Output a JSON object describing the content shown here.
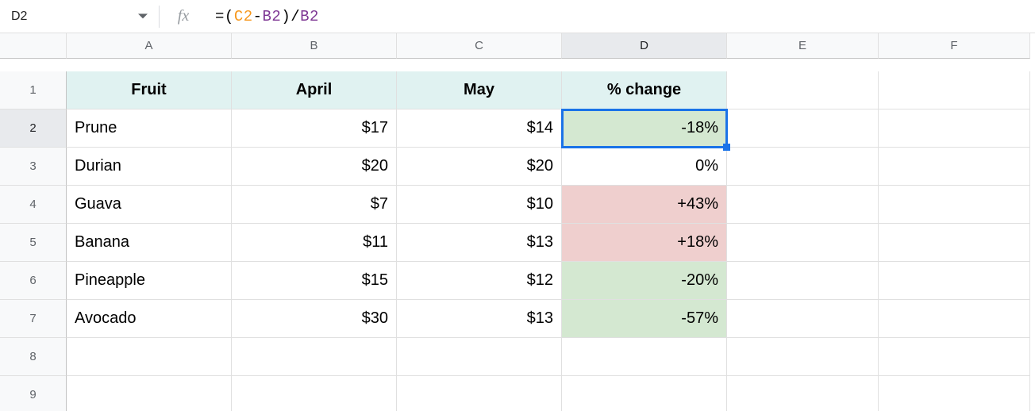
{
  "formula_bar": {
    "cell_ref": "D2",
    "fx_label": "fx",
    "formula_tokens": [
      {
        "t": "=",
        "c": "tok-op"
      },
      {
        "t": "(",
        "c": "tok-punct"
      },
      {
        "t": "C2",
        "c": "tok-ref1"
      },
      {
        "t": "-",
        "c": "tok-op"
      },
      {
        "t": "B2",
        "c": "tok-ref2"
      },
      {
        "t": ")",
        "c": "tok-punct"
      },
      {
        "t": "/",
        "c": "tok-op"
      },
      {
        "t": "B2",
        "c": "tok-ref2"
      }
    ]
  },
  "columns": [
    "A",
    "B",
    "C",
    "D",
    "E",
    "F"
  ],
  "selected_col_index": 3,
  "selected_row_index": 1,
  "rows": [
    {
      "n": "1",
      "cells": [
        {
          "v": "Fruit",
          "header": true
        },
        {
          "v": "April",
          "header": true
        },
        {
          "v": "May",
          "header": true
        },
        {
          "v": "% change",
          "header": true
        },
        {
          "v": ""
        },
        {
          "v": ""
        }
      ]
    },
    {
      "n": "2",
      "cells": [
        {
          "v": "Prune",
          "align": "left"
        },
        {
          "v": "$17",
          "align": "right"
        },
        {
          "v": "$14",
          "align": "right"
        },
        {
          "v": "-18%",
          "align": "right",
          "fill": "green",
          "selected": true
        },
        {
          "v": ""
        },
        {
          "v": ""
        }
      ]
    },
    {
      "n": "3",
      "cells": [
        {
          "v": "Durian",
          "align": "left"
        },
        {
          "v": "$20",
          "align": "right"
        },
        {
          "v": "$20",
          "align": "right"
        },
        {
          "v": "0%",
          "align": "right"
        },
        {
          "v": ""
        },
        {
          "v": ""
        }
      ]
    },
    {
      "n": "4",
      "cells": [
        {
          "v": "Guava",
          "align": "left"
        },
        {
          "v": "$7",
          "align": "right"
        },
        {
          "v": "$10",
          "align": "right"
        },
        {
          "v": "+43%",
          "align": "right",
          "fill": "red"
        },
        {
          "v": ""
        },
        {
          "v": ""
        }
      ]
    },
    {
      "n": "5",
      "cells": [
        {
          "v": "Banana",
          "align": "left"
        },
        {
          "v": "$11",
          "align": "right"
        },
        {
          "v": "$13",
          "align": "right"
        },
        {
          "v": "+18%",
          "align": "right",
          "fill": "red"
        },
        {
          "v": ""
        },
        {
          "v": ""
        }
      ]
    },
    {
      "n": "6",
      "cells": [
        {
          "v": "Pineapple",
          "align": "left"
        },
        {
          "v": "$15",
          "align": "right"
        },
        {
          "v": "$12",
          "align": "right"
        },
        {
          "v": "-20%",
          "align": "right",
          "fill": "green"
        },
        {
          "v": ""
        },
        {
          "v": ""
        }
      ]
    },
    {
      "n": "7",
      "cells": [
        {
          "v": "Avocado",
          "align": "left"
        },
        {
          "v": "$30",
          "align": "right"
        },
        {
          "v": "$13",
          "align": "right"
        },
        {
          "v": "-57%",
          "align": "right",
          "fill": "green"
        },
        {
          "v": ""
        },
        {
          "v": ""
        }
      ]
    },
    {
      "n": "8",
      "cells": [
        {
          "v": ""
        },
        {
          "v": ""
        },
        {
          "v": ""
        },
        {
          "v": ""
        },
        {
          "v": ""
        },
        {
          "v": ""
        }
      ]
    },
    {
      "n": "9",
      "cells": [
        {
          "v": ""
        },
        {
          "v": ""
        },
        {
          "v": ""
        },
        {
          "v": ""
        },
        {
          "v": ""
        },
        {
          "v": ""
        }
      ]
    }
  ]
}
